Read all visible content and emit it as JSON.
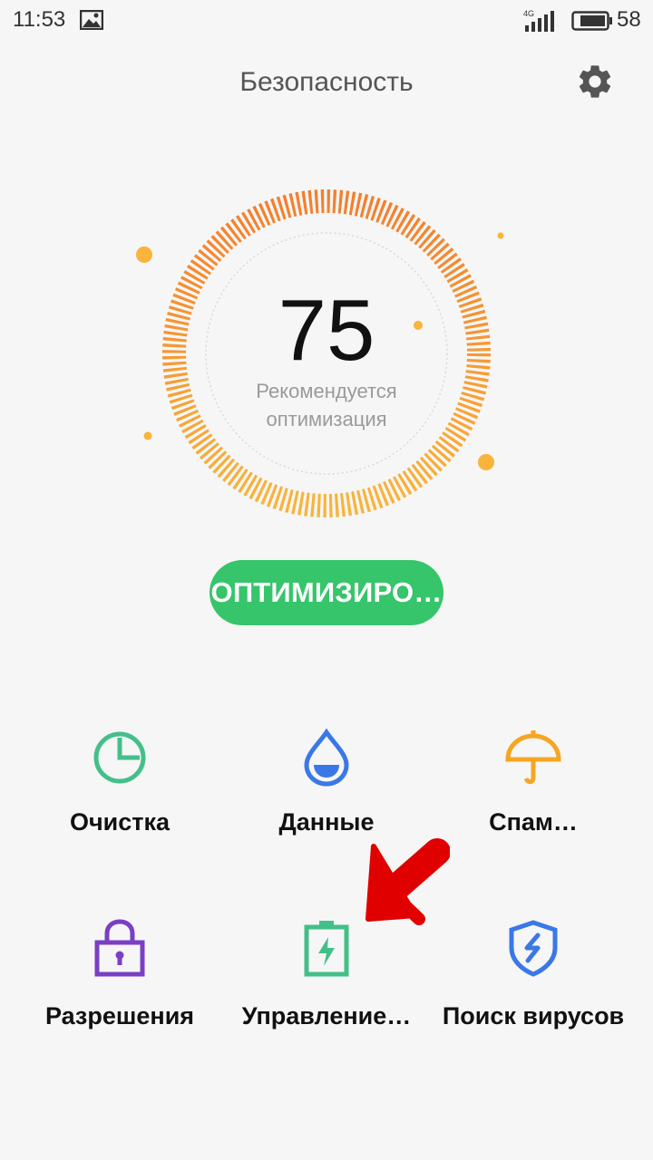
{
  "status_bar": {
    "time": "11:53",
    "network": "4G",
    "battery": "58",
    "gallery_icon": "image-icon",
    "signal_icon": "signal-icon",
    "battery_icon": "battery-icon"
  },
  "header": {
    "title": "Безопасность",
    "settings_icon": "gear-icon"
  },
  "score": {
    "value": "75",
    "caption_line1": "Рекомендуется",
    "caption_line2": "оптимизация",
    "ring_colors": [
      "#f47f2d",
      "#f9b43a"
    ]
  },
  "optimize_button": {
    "label": "ОПТИМИЗИРО…",
    "color": "#36c56a"
  },
  "tools": [
    {
      "label": "Очистка",
      "icon": "clock-pie-icon",
      "color": "#45bf8a"
    },
    {
      "label": "Данные",
      "icon": "water-drop-icon",
      "color": "#3b78e7"
    },
    {
      "label": "Спам…",
      "icon": "umbrella-icon",
      "color": "#f5a623"
    },
    {
      "label": "Разрешения",
      "icon": "lock-icon",
      "color": "#7b3fc4"
    },
    {
      "label": "Управление…",
      "icon": "battery-charging-icon",
      "color": "#43bf88"
    },
    {
      "label": "Поиск вирусов",
      "icon": "shield-icon",
      "color": "#3b78e7"
    }
  ],
  "annotation": {
    "arrow_icon": "red-arrow-icon",
    "color": "#e00000"
  }
}
